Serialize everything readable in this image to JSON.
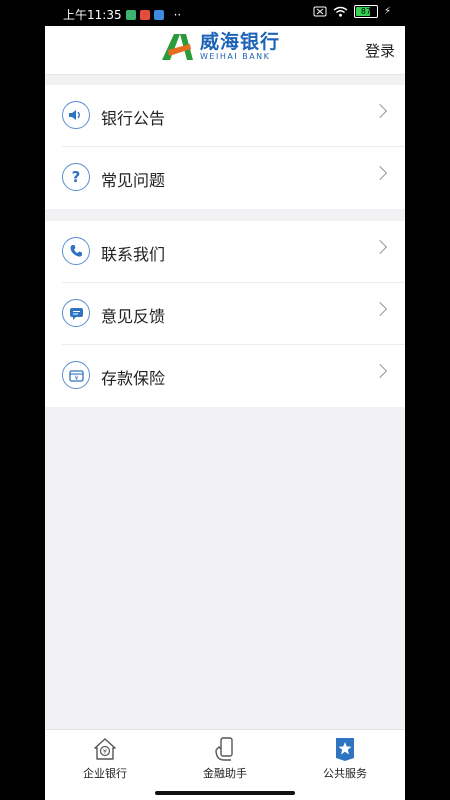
{
  "status": {
    "time": "上午11:35",
    "dots": "··",
    "battery": "87"
  },
  "header": {
    "logo_cn": "威海银行",
    "logo_en": "WEIHAI BANK",
    "login": "登录"
  },
  "menu_group1": [
    {
      "label": "银行公告",
      "icon": "speaker-icon"
    },
    {
      "label": "常见问题",
      "icon": "question-icon"
    }
  ],
  "menu_group2": [
    {
      "label": "联系我们",
      "icon": "phone-icon"
    },
    {
      "label": "意见反馈",
      "icon": "chat-icon"
    },
    {
      "label": "存款保险",
      "icon": "deposit-icon"
    }
  ],
  "tabs": [
    {
      "label": "企业银行",
      "icon": "house-icon",
      "active": false
    },
    {
      "label": "金融助手",
      "icon": "assistant-icon",
      "active": false
    },
    {
      "label": "公共服务",
      "icon": "star-bookmark-icon",
      "active": true
    }
  ],
  "colors": {
    "brand_blue": "#1d63b6",
    "logo_green": "#2a9a3a",
    "logo_orange": "#e66a1f",
    "background": "#f2f2f5"
  }
}
